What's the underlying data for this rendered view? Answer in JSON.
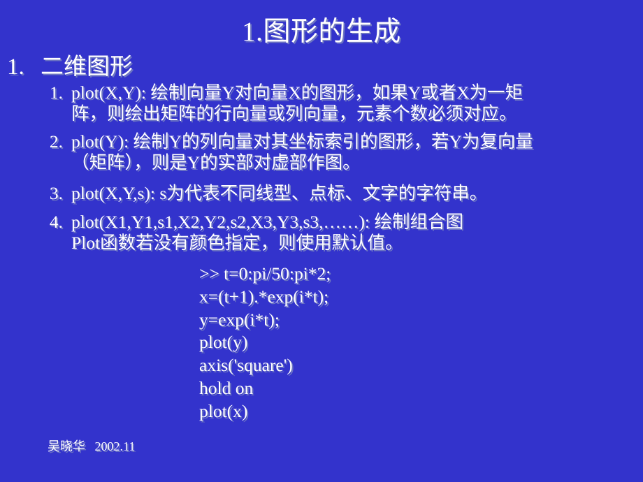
{
  "slide": {
    "title": "1.图形的生成",
    "heading": {
      "marker": "1.",
      "text": "二维图形"
    },
    "items": [
      {
        "marker": "1.",
        "line1": "plot(X,Y): 绘制向量Y对向量X的图形，如果Y或者X为一矩",
        "line2": "阵，则绘出矩阵的行向量或列向量，元素个数必须对应。"
      },
      {
        "marker": "2.",
        "line1": "plot(Y): 绘制Y的列向量对其坐标索引的图形，若Y为复向量",
        "line2": "（矩阵），则是Y的实部对虚部作图。"
      },
      {
        "marker": "3.",
        "line1": "plot(X,Y,s): s为代表不同线型、点标、文字的字符串。",
        "line2": ""
      },
      {
        "marker": "4.",
        "line1": "plot(X1,Y1,s1,X2,Y2,s2,X3,Y3,s3,……): 绘制组合图",
        "line2": "Plot函数若没有颜色指定，则使用默认值。"
      }
    ],
    "code_lines": [
      ">> t=0:pi/50:pi*2;",
      "x=(t+1).*exp(i*t);",
      "y=exp(i*t);",
      "plot(y)",
      "axis('square')",
      "hold on",
      "plot(x)"
    ],
    "footer": "吴晓华   2002.11",
    "colors": {
      "background": "#3333cc",
      "text": "#ffffff",
      "shadow": "#7882be"
    }
  }
}
